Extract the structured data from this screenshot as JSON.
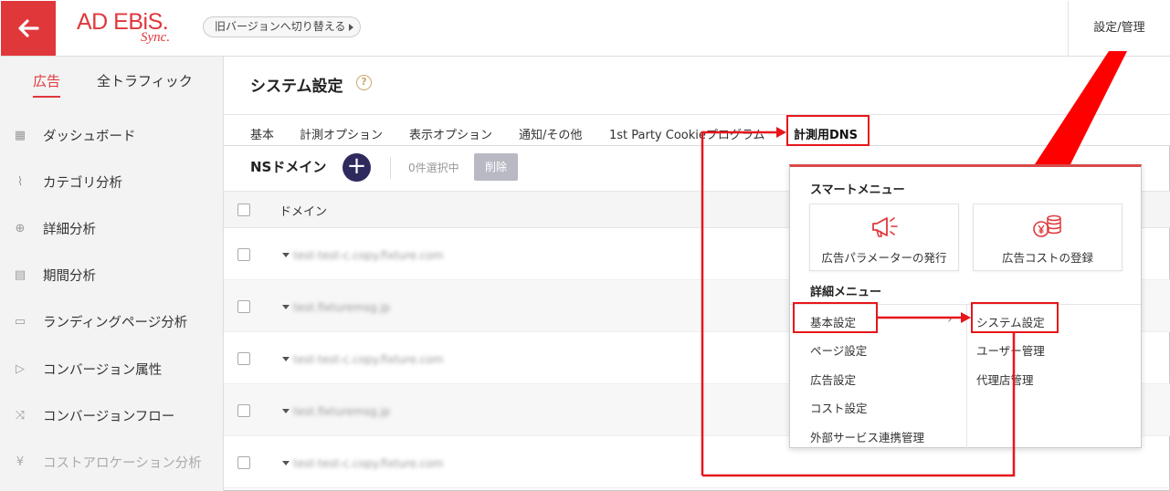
{
  "header": {
    "logo_main": "AD EBiS.",
    "logo_sub": "Sync.",
    "switch_version_label": "旧バージョンへ切り替える",
    "settings_link": "設定/管理"
  },
  "sidebar": {
    "tabs": [
      {
        "label": "広告",
        "active": true
      },
      {
        "label": "全トラフィック",
        "active": false
      }
    ],
    "items": [
      {
        "label": "ダッシュボード",
        "icon": "grid-icon",
        "glyph": "▦"
      },
      {
        "label": "カテゴリ分析",
        "icon": "trend-icon",
        "glyph": "⌇"
      },
      {
        "label": "詳細分析",
        "icon": "magnifier-icon",
        "glyph": "⊕"
      },
      {
        "label": "期間分析",
        "icon": "calendar-icon",
        "glyph": "▤"
      },
      {
        "label": "ランディングページ分析",
        "icon": "window-icon",
        "glyph": "▭"
      },
      {
        "label": "コンバージョン属性",
        "icon": "flag-icon",
        "glyph": "▷"
      },
      {
        "label": "コンバージョンフロー",
        "icon": "shuffle-icon",
        "glyph": "⤨"
      },
      {
        "label": "コストアロケーション分析",
        "icon": "yen-icon",
        "glyph": "¥"
      }
    ]
  },
  "main": {
    "title": "システム設定",
    "help_glyph": "?",
    "tabs": [
      {
        "label": "基本"
      },
      {
        "label": "計測オプション"
      },
      {
        "label": "表示オプション"
      },
      {
        "label": "通知/その他"
      },
      {
        "label": "1st Party Cookieプログラム"
      },
      {
        "label": "計測用DNS"
      }
    ],
    "active_tab": "計測用DNS",
    "section_title": "NSドメイン",
    "add_glyph": "+",
    "selected_count": "0件選択中",
    "delete_label": "削除",
    "table": {
      "column": "ドメイン",
      "rows": [
        {
          "domain": "test-test-c.copy.fixture.com"
        },
        {
          "domain": "test.fixturemsg.jp"
        },
        {
          "domain": "test-test-c.copy.fixture.com"
        },
        {
          "domain": "test.fixturemsg.jp"
        },
        {
          "domain": "test-test-c.copy.fixture.com"
        }
      ]
    }
  },
  "dropdown": {
    "smart_menu_title": "スマートメニュー",
    "smart_cards": [
      {
        "label": "広告パラメーターの発行",
        "icon": "megaphone-icon"
      },
      {
        "label": "広告コストの登録",
        "icon": "yen-coins-icon"
      }
    ],
    "detail_menu_title": "詳細メニュー",
    "left_items": [
      "基本設定",
      "ページ設定",
      "広告設定",
      "コスト設定",
      "外部サービス連携管理"
    ],
    "right_items": [
      "システム設定",
      "ユーザー管理",
      "代理店管理"
    ],
    "arrow_glyph": "›"
  },
  "colors": {
    "brand_red": "#e0373b",
    "annotation_red": "#e6161b",
    "add_button": "#2e2a5e"
  }
}
